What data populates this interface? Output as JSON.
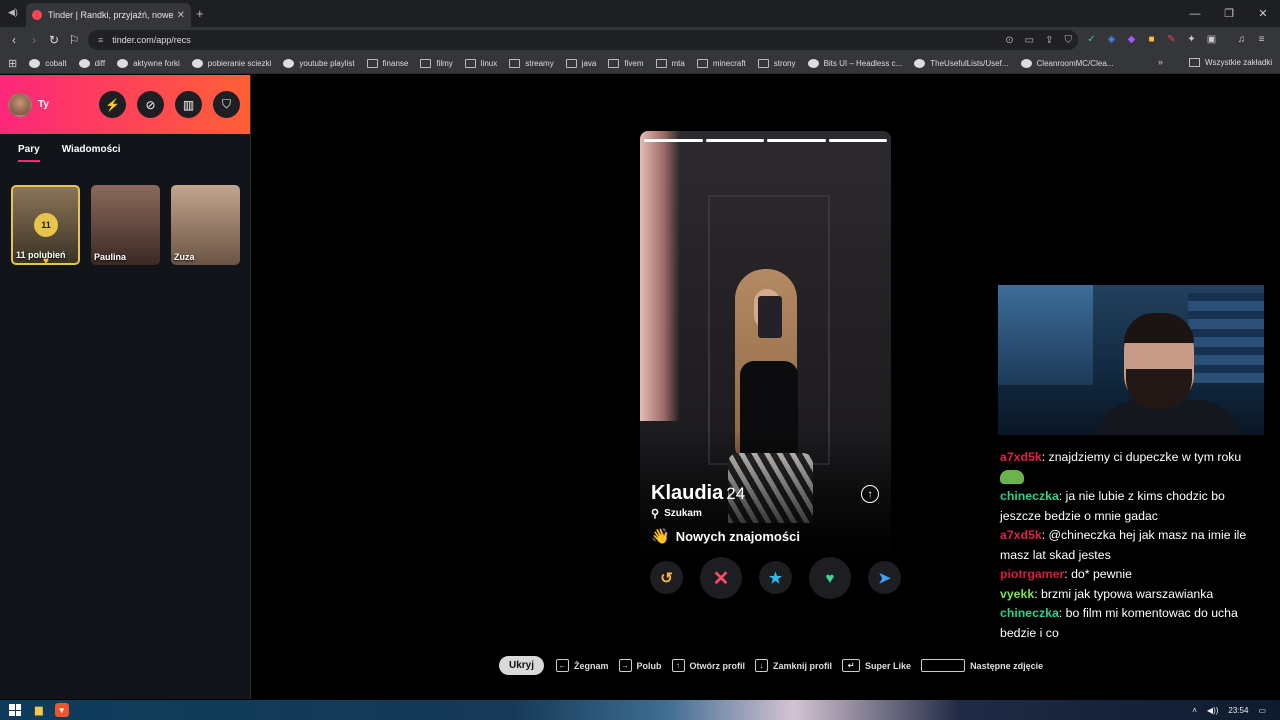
{
  "browser": {
    "tab_title": "Tinder | Randki, przyjaźń, nowe z",
    "url": "tinder.com/app/recs",
    "bookmarks": [
      "cobalt",
      "diff",
      "aktywne forki",
      "pobieranie sciezki",
      "youtube playlist",
      "finanse",
      "filmy",
      "linux",
      "streamy",
      "java",
      "fivem",
      "mta",
      "minecraft",
      "strony",
      "Bits UI – Headless c...",
      "TheUsefulLists/Usef...",
      "CleanroomMC/Clea..."
    ],
    "all_bookmarks": "Wszystkie zakładki"
  },
  "sidebar": {
    "user_label": "Ty",
    "tabs": [
      "Pary",
      "Wiadomości"
    ],
    "likes_count": "11",
    "likes_label": "11 polubień",
    "matches": [
      "Paulina",
      "Zuza"
    ]
  },
  "profile": {
    "name": "Klaudia",
    "age": "24",
    "looking_label": "Szukam",
    "looking_for": "Nowych znajomości",
    "photo_count": 4,
    "photo_index": 1
  },
  "hints": {
    "hide": "Ukryj",
    "items": [
      "Żegnam",
      "Polub",
      "Otwórz profil",
      "Zamknij profil",
      "Super Like",
      "Następne zdjęcie"
    ]
  },
  "chat": [
    {
      "user": "a7xd5k",
      "color": "#e0224f",
      "text": ": znajdziemy ci dupeczke w tym roku"
    },
    {
      "user": "chineczka",
      "color": "#2fcf8a",
      "text": ": ja nie lubie z kims chodzic bo jeszcze bedzie o mnie gadac"
    },
    {
      "user": "a7xd5k",
      "color": "#e0224f",
      "text": ": @chineczka hej jak masz na imie ile masz lat skad jestes"
    },
    {
      "user": "piotrgamer",
      "color": "#d01e3c",
      "text": ": do* pewnie"
    },
    {
      "user": "vyekk",
      "color": "#7de34a",
      "text": ": brzmi jak typowa warszawianka"
    },
    {
      "user": "chineczka",
      "color": "#2fcf8a",
      "text": ": bo film mi komentowac do ucha bedzie i co"
    }
  ],
  "taskbar": {
    "time": "23:54"
  }
}
